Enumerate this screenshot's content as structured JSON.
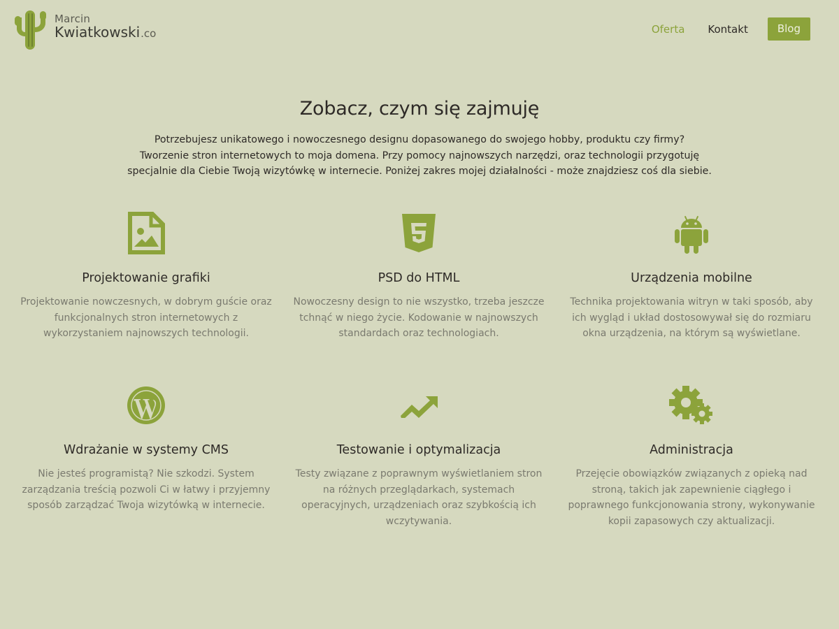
{
  "brand": {
    "first_name": "Marcin",
    "last_name": "Kwiatkowski",
    "suffix": ".co",
    "accent_color": "#8ca33b",
    "background_color": "#d6d9bf"
  },
  "nav": {
    "items": [
      {
        "label": "Oferta",
        "active": true
      },
      {
        "label": "Kontakt",
        "active": false
      },
      {
        "label": "Blog",
        "active": false
      }
    ]
  },
  "intro": {
    "title": "Zobacz, czym się zajmuję",
    "lines": [
      "Potrzebujesz unikatowego i nowoczesnego designu dopasowanego do swojego hobby, produktu czy firmy?",
      "Tworzenie stron internetowych to moja domena. Przy pomocy najnowszych narzędzi, oraz technologii przygotuję",
      "specjalnie dla Ciebie Twoją wizytówkę w internecie. Poniżej zakres mojej działalności - może znajdziesz coś dla siebie."
    ]
  },
  "services": [
    {
      "icon": "image-file-icon",
      "title": "Projektowanie grafiki",
      "description": "Projektowanie nowczesnych, w dobrym guście oraz funkcjonalnych stron internetowych z wykorzystaniem najnowszych technologii."
    },
    {
      "icon": "html5-icon",
      "title": "PSD do HTML",
      "description": "Nowoczesny design to nie wszystko, trzeba jeszcze tchnąć w niego życie. Kodowanie w najnowszych standardach oraz technologiach."
    },
    {
      "icon": "android-icon",
      "title": "Urządzenia mobilne",
      "description": "Technika projektowania witryn w taki sposób, aby ich wygląd i układ dostosowywał się do rozmiaru okna urządzenia, na którym są wyświetlane."
    },
    {
      "icon": "wordpress-icon",
      "title": "Wdrażanie w systemy CMS",
      "description": "Nie jesteś programistą? Nie szkodzi. System zarządzania treścią pozwoli Ci w łatwy i przyjemny sposób zarządzać Twoja wizytówką w internecie."
    },
    {
      "icon": "trending-up-icon",
      "title": "Testowanie i optymalizacja",
      "description": "Testy związane z poprawnym wyświetlaniem stron na różnych przeglądarkach, systemach operacyjnych, urządzeniach oraz szybkością ich wczytywania."
    },
    {
      "icon": "gears-icon",
      "title": "Administracja",
      "description": "Przejęcie obowiązków związanych z opieką nad stroną, takich jak zapewnienie ciągłego i poprawnego funkcjonowania strony, wykonywanie kopii zapasowych czy aktualizacji."
    }
  ]
}
